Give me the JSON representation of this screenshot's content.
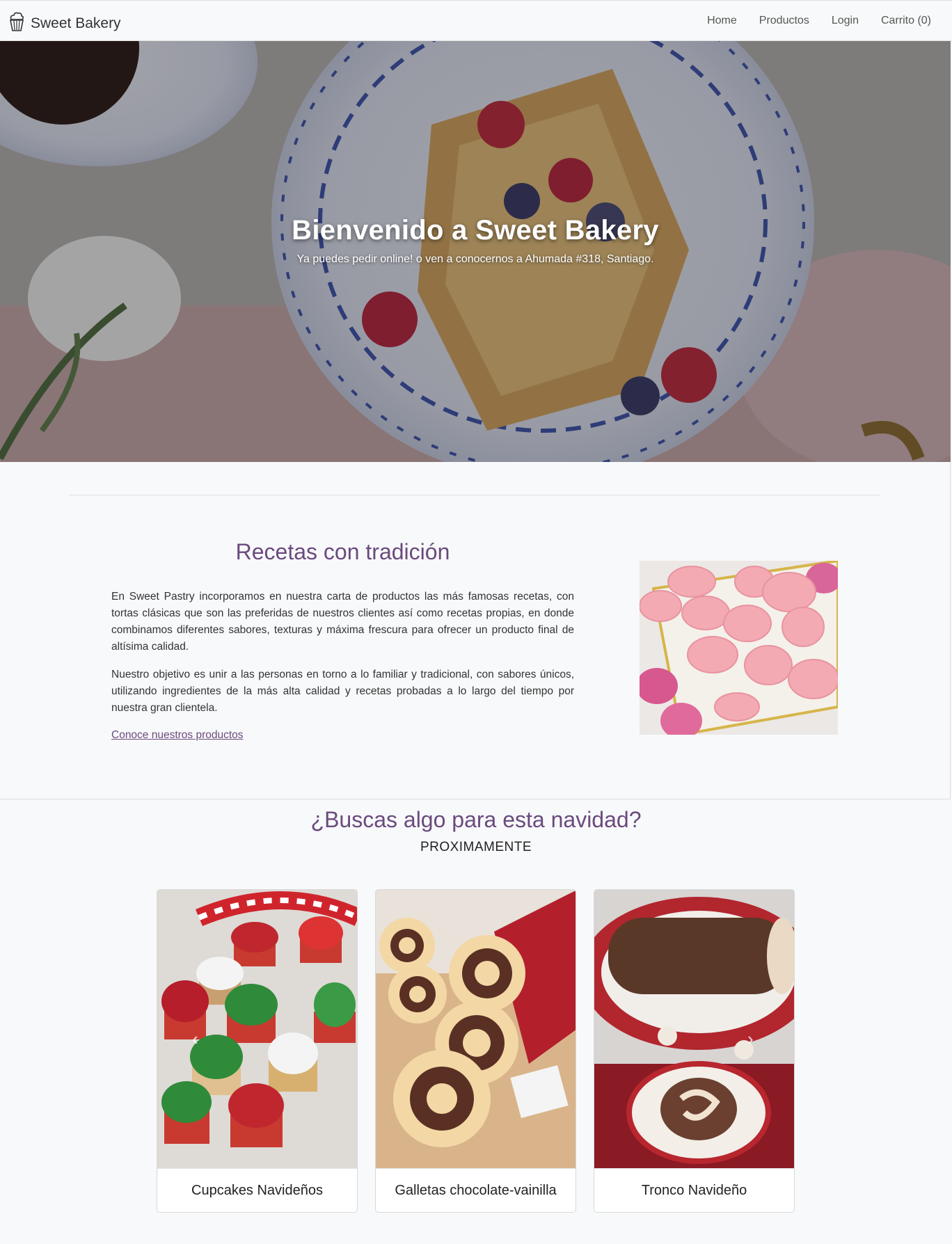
{
  "navbar": {
    "brand": "Sweet Bakery",
    "brand_icon": "cupcake-icon",
    "links": [
      "Home",
      "Productos",
      "Login",
      "Carrito (0)"
    ]
  },
  "hero": {
    "title": "Bienvenido a Sweet Bakery",
    "subtitle": "Ya puedes pedir online! o ven a conocernos a Ahumada #318, Santiago."
  },
  "about": {
    "title": "Recetas con tradición",
    "paragraphs": [
      "En Sweet Pastry incorporamos en nuestra carta de productos las más famosas recetas, con tortas clásicas que son las preferidas de nuestros clientes así como recetas propias, en donde combinamos diferentes sabores, texturas y máxima frescura para ofrecer un producto final de altísima calidad.",
      "Nuestro objetivo es unir a las personas en torno a lo familiar y tradicional, con sabores únicos, utilizando ingredientes de la más alta calidad y recetas probadas a lo largo del tiempo por nuestra gran clientela."
    ],
    "link": "Conoce nuestros productos"
  },
  "christmas": {
    "title": "¿Buscas algo para esta navidad?",
    "subtitle": "PROXIMAMENTE",
    "cards": [
      {
        "label": "Cupcakes Navideños"
      },
      {
        "label": "Galletas chocolate-vainilla"
      },
      {
        "label": "Tronco Navideño"
      }
    ]
  },
  "colors": {
    "accent": "#6b4a7d",
    "navbar_bg": "#f8f9fa",
    "page_bg": "#f8f9fb"
  }
}
